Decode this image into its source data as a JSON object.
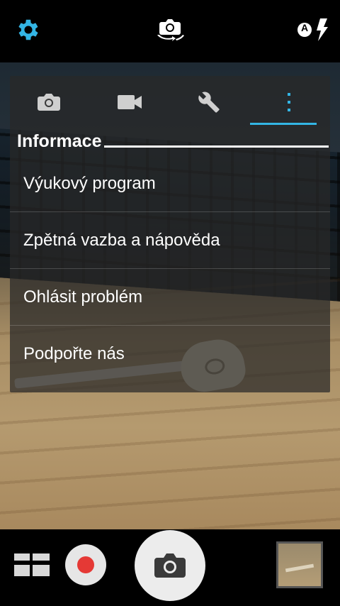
{
  "top_bar": {
    "settings_icon": "gear-icon",
    "switch_camera_icon": "switch-camera-icon",
    "flash_icon": "flash-auto-icon",
    "flash_mode_letter": "A",
    "accent_color": "#33b5e5"
  },
  "menu": {
    "tabs": [
      {
        "icon": "camera-icon",
        "selected": false
      },
      {
        "icon": "video-icon",
        "selected": false
      },
      {
        "icon": "wrench-icon",
        "selected": false
      },
      {
        "icon": "more-vert-icon",
        "selected": true
      }
    ],
    "section_title": "Informace",
    "items": [
      {
        "label": "Výukový program"
      },
      {
        "label": "Zpětná vazba a nápověda"
      },
      {
        "label": "Ohlásit problém"
      },
      {
        "label": "Podpořte nás"
      }
    ]
  },
  "bottom_bar": {
    "mode_grid_icon": "grid-icon",
    "record_icon": "record-icon",
    "record_color": "#e53935",
    "shutter_icon": "camera-icon",
    "gallery_icon": "gallery-thumbnail"
  }
}
